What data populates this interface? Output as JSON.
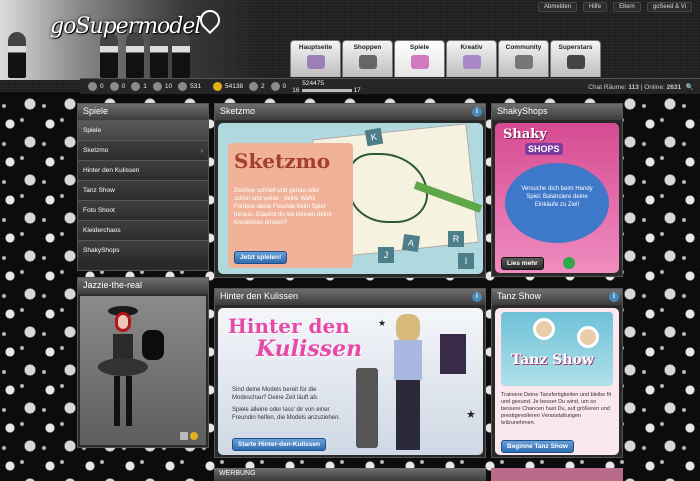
{
  "header": {
    "logo": "goSupermodel",
    "top_links": [
      "Abmelden",
      "Hilfe",
      "Eltern",
      "goSeed & Vi"
    ],
    "tabs": [
      "Hauptseite",
      "Shoppen",
      "Spiele",
      "Kreativ",
      "Community",
      "Superstars"
    ],
    "active_tab": "Spiele"
  },
  "status": {
    "items": [
      "0",
      "0",
      "1",
      "10",
      "531",
      "54138",
      "2",
      "0"
    ],
    "score": "524475",
    "level_from": "16",
    "level_to": "17",
    "chat_label": "Chat Räume:",
    "chat_count": "113",
    "online_label": "Online:",
    "online_count": "2631"
  },
  "sidebar": {
    "title": "Spiele",
    "items": [
      "Spiele",
      "Sketzmo",
      "Hinter den Kulissen",
      "Tanz Show",
      "Foto Shoot",
      "Kleiderchaos",
      "ShakyShops"
    ]
  },
  "avatar_panel": {
    "title": "Jazzie-the-real"
  },
  "sketzmo": {
    "title": "Sketzmo",
    "logo": "Sketzmo",
    "text": "Zeichne schnell und genau oder schön und weise - deine Wahl! Fordere deine Freunde beim Spiel heraus. Glaubst du sie können deine Kreationen erraten?",
    "button": "Jetzt spielen!",
    "tiles": [
      "K",
      "J",
      "A",
      "R",
      "I"
    ]
  },
  "kulissen": {
    "title": "Hinter den Kulissen",
    "logo_line1": "Hinter den",
    "logo_line2": "Kulissen",
    "text1": "Sind deine Models bereit für die Modeschau? Deine Zeit läuft ab.",
    "text2": "Spiele alleine oder lass' dir von einer Freundin helfen, die Models anzuziehen.",
    "button": "Starte Hinter-den-Kulissen"
  },
  "shakyshops": {
    "title": "ShakyShops",
    "logo1": "Shaky",
    "logo2": "SHOPS",
    "text": "Versuche dich beim Handy Spiel: Balanciere deine Einkäufe zu Ziel!",
    "button": "Lies mehr"
  },
  "tanzshow": {
    "title": "Tanz Show",
    "logo": "Tanz Show",
    "text": "Trainiere Deine Tanzfertigkeiten und bleibe fit und gesund. Je besser Du wirst, um so bessere Chancen hast Du, auf größeren und prestigevolleren Veranstaltungen teilzunehmen.",
    "button": "Beginne Tanz Show"
  },
  "werbung": {
    "title": "WERBUNG"
  }
}
